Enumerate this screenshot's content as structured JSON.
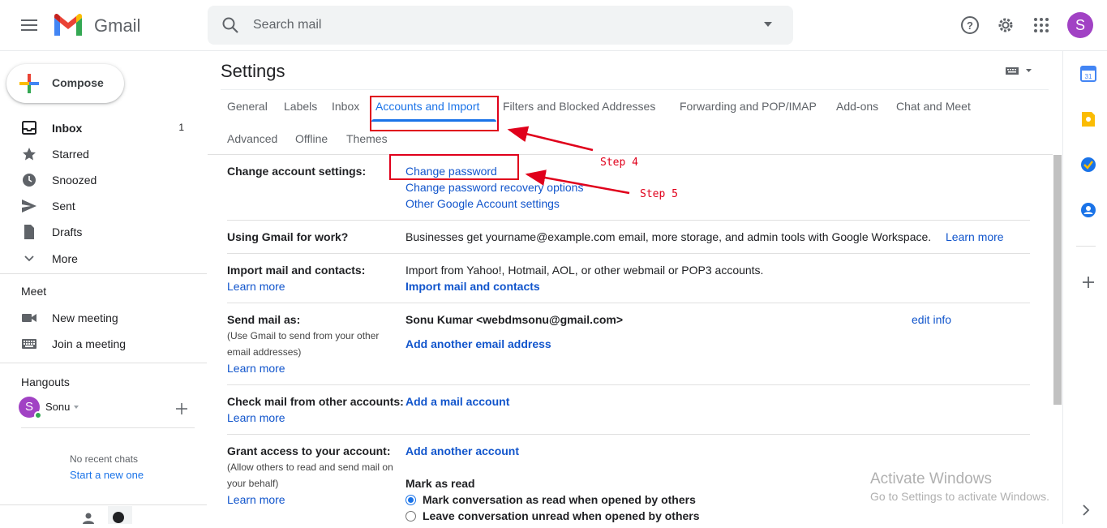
{
  "header": {
    "app_name": "Gmail",
    "search_placeholder": "Search mail",
    "avatar_letter": "S"
  },
  "compose": {
    "label": "Compose"
  },
  "nav": {
    "items": [
      {
        "label": "Inbox",
        "count": "1"
      },
      {
        "label": "Starred",
        "count": ""
      },
      {
        "label": "Snoozed",
        "count": ""
      },
      {
        "label": "Sent",
        "count": ""
      },
      {
        "label": "Drafts",
        "count": ""
      },
      {
        "label": "More",
        "count": ""
      }
    ],
    "meet_title": "Meet",
    "meet_items": [
      "New meeting",
      "Join a meeting"
    ],
    "hangouts_title": "Hangouts",
    "hangouts_user": "Sonu",
    "hangouts_user_letter": "S",
    "no_chats": "No recent chats",
    "start_new": "Start a new one"
  },
  "settings": {
    "title": "Settings",
    "tabs_row1": [
      "General",
      "Labels",
      "Inbox",
      "Accounts and Import",
      "Filters and Blocked Addresses",
      "Forwarding and POP/IMAP",
      "Add-ons",
      "Chat and Meet"
    ],
    "tabs_row2": [
      "Advanced",
      "Offline",
      "Themes"
    ],
    "active_tab": "Accounts and Import",
    "rows": {
      "change_account": {
        "label": "Change account settings:",
        "links": [
          "Change password",
          "Change password recovery options",
          "Other Google Account settings"
        ]
      },
      "gmail_work": {
        "label": "Using Gmail for work?",
        "text": "Businesses get yourname@example.com email, more storage, and admin tools with Google Workspace.",
        "link": "Learn more"
      },
      "import_mail": {
        "label": "Import mail and contacts:",
        "learn_more": "Learn more",
        "text": "Import from Yahoo!, Hotmail, AOL, or other webmail or POP3 accounts.",
        "link": "Import mail and contacts"
      },
      "send_as": {
        "label": "Send mail as:",
        "sub": "(Use Gmail to send from your other email addresses)",
        "learn_more": "Learn more",
        "address": "Sonu Kumar <webdmsonu@gmail.com>",
        "edit": "edit info",
        "add": "Add another email address"
      },
      "check_mail": {
        "label": "Check mail from other accounts:",
        "learn_more": "Learn more",
        "add": "Add a mail account"
      },
      "grant_access": {
        "label": "Grant access to your account:",
        "sub": "(Allow others to read and send mail on your behalf)",
        "learn_more": "Learn more",
        "add": "Add another account",
        "mark_title": "Mark as read",
        "options": [
          {
            "label": "Mark conversation as read when opened by others",
            "checked": true
          },
          {
            "label": "Leave conversation unread when opened by others",
            "checked": false
          }
        ]
      }
    }
  },
  "annotations": {
    "step4": "Step 4",
    "step5": "Step 5",
    "color": "#e0001b"
  },
  "watermark": {
    "title": "Activate Windows",
    "sub": "Go to Settings to activate Windows."
  },
  "colors": {
    "accent": "#1a73e8",
    "link": "#1155cc",
    "avatar": "#a142c4"
  }
}
